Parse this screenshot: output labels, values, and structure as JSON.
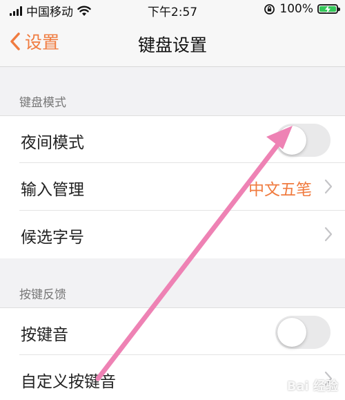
{
  "status_bar": {
    "carrier": "中国移动",
    "time": "下午2:57",
    "battery_percent": "100%",
    "icons": [
      "signal-icon",
      "wifi-icon",
      "orientation-lock-icon",
      "battery-charging-icon"
    ]
  },
  "nav": {
    "back_label": "设置",
    "title": "键盘设置"
  },
  "sections": [
    {
      "header": "键盘模式",
      "rows": [
        {
          "label": "夜间模式",
          "type": "toggle",
          "on": false
        },
        {
          "label": "输入管理",
          "type": "value",
          "value": "中文五笔"
        },
        {
          "label": "候选字号",
          "type": "chevron"
        }
      ]
    },
    {
      "header": "按键反馈",
      "rows": [
        {
          "label": "按键音",
          "type": "toggle",
          "on": false
        },
        {
          "label": "自定义按键音",
          "type": "chevron"
        }
      ]
    }
  ],
  "watermark": "Bai 经验",
  "colors": {
    "accent": "#f07b3f",
    "annotation_arrow": "#ee82b4",
    "toggle_off": "#e9e9ea",
    "background": "#f2f2f4"
  }
}
